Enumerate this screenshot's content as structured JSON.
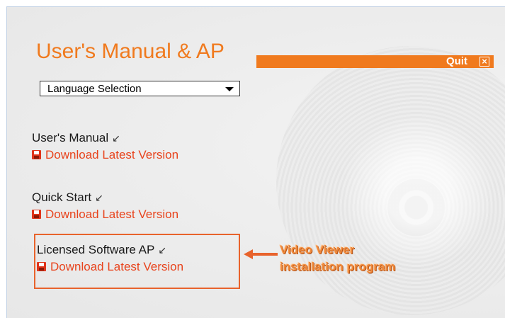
{
  "header": {
    "title": "User's Manual & AP",
    "quit_label": "Quit",
    "quit_icon": "close-icon"
  },
  "language_select": {
    "selected": "Language Selection"
  },
  "sections": [
    {
      "title": "User's Manual",
      "link": "Download Latest Version"
    },
    {
      "title": "Quick Start",
      "link": "Download Latest Version"
    },
    {
      "title": "Licensed Software AP",
      "link": "Download Latest Version"
    }
  ],
  "callout": {
    "line1": "Video Viewer",
    "line2": "installation program"
  },
  "colors": {
    "accent": "#f07a1e",
    "link": "#e8431c",
    "highlight": "#e8632c"
  }
}
